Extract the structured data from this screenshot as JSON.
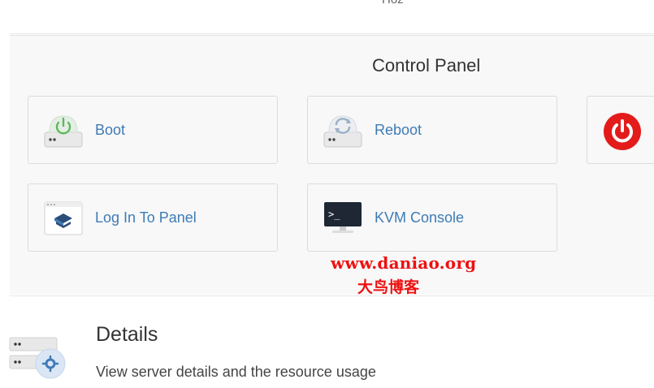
{
  "top": {
    "cut_text": "Hoz"
  },
  "control_panel": {
    "title": "Control Panel",
    "cards": {
      "boot": {
        "label": "Boot",
        "icon": "server-power-icon",
        "accent": "#5cb85c"
      },
      "reboot": {
        "label": "Reboot",
        "icon": "server-refresh-icon",
        "accent": "#9ab0c8"
      },
      "power": {
        "icon": "power-icon",
        "accent": "#e31b1b"
      },
      "login": {
        "label": "Log In To Panel",
        "icon": "panel-login-icon",
        "accent": "#2a4d7a"
      },
      "kvm": {
        "label": "KVM Console",
        "icon": "terminal-monitor-icon",
        "accent": "#1e2733"
      }
    }
  },
  "watermark": {
    "url": "www.daniao.org",
    "chinese": "大鸟博客",
    "color": "#ee1111"
  },
  "details": {
    "title": "Details",
    "subtitle": "View server details and the resource usage",
    "icon": "server-settings-icon"
  },
  "colors": {
    "link": "#3e7bb6",
    "panel_bg": "#f8f8f8",
    "card_border": "#dcdcdc"
  }
}
